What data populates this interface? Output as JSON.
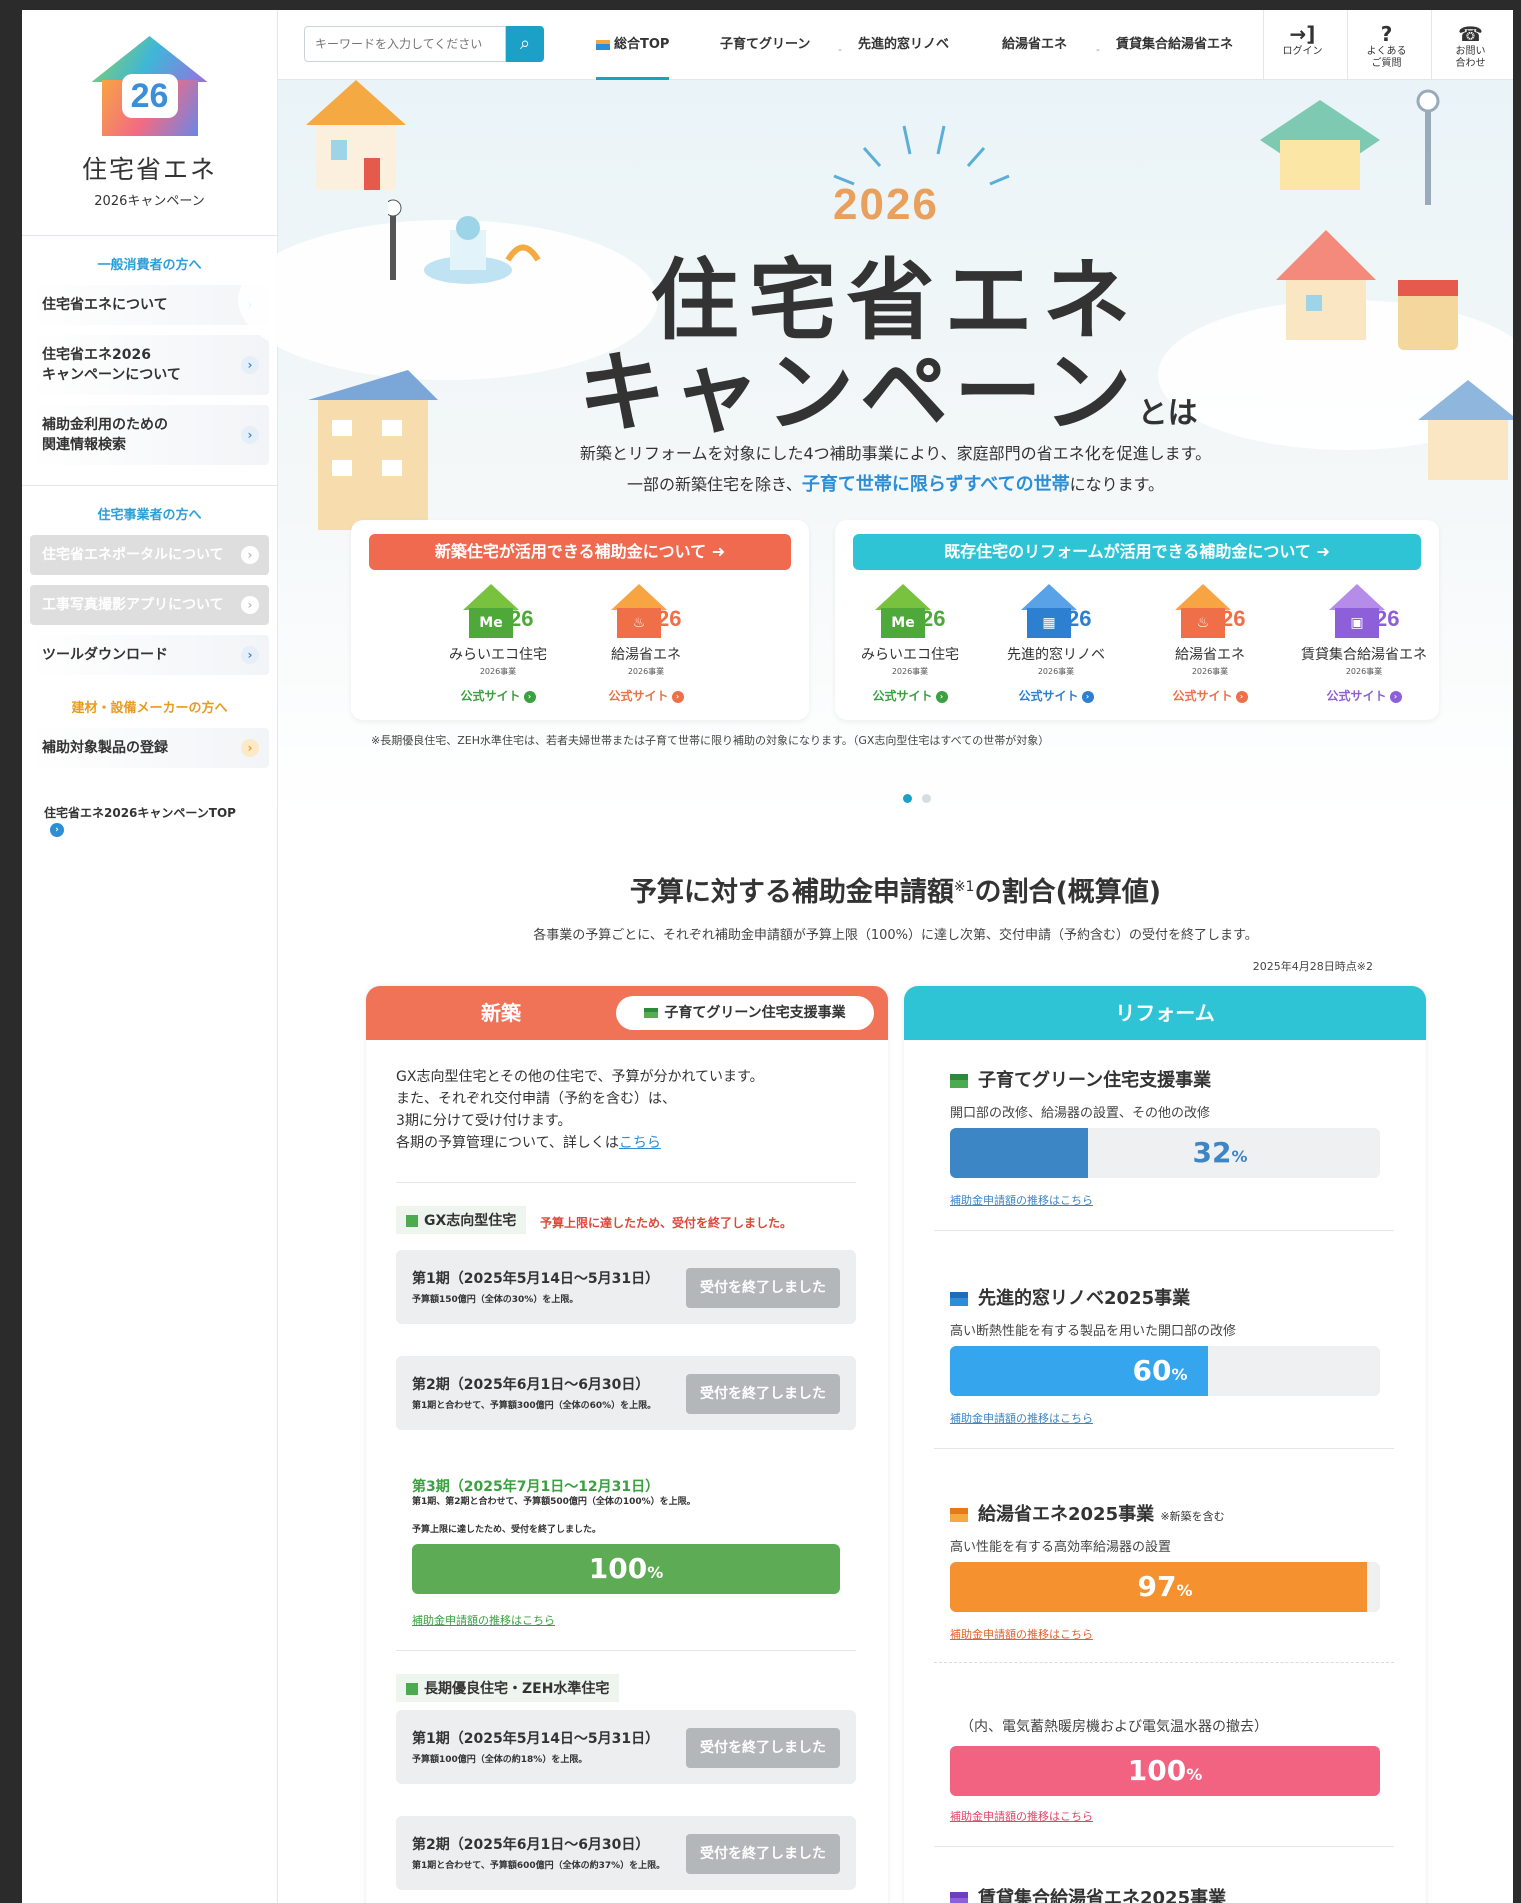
{
  "sidebar": {
    "logo_number": "26",
    "logo_title": "住宅省エネ",
    "logo_sub": "2026キャンペーン",
    "consumer_head": "一般消費者の方へ",
    "consumer_items": [
      "住宅省エネについて",
      "住宅省エネ2026\nキャンペーンについて",
      "補助金利用のための\n関連情報検索"
    ],
    "business_head": "住宅事業者の方へ",
    "business_items": [
      "住宅省エネポータルについて",
      "工事写真撮影アプリについて",
      "ツールダウンロード"
    ],
    "maker_head": "建材・設備メーカーの方へ",
    "maker_items": [
      "補助対象製品の登録"
    ],
    "top_link": "住宅省エネ2026キャンペーンTOP"
  },
  "topbar": {
    "search_placeholder": "キーワードを入力してください",
    "nav": [
      "総合TOP",
      "子育てグリーン",
      "先進的窓リノベ",
      "給湯省エネ",
      "賃貸集合給湯省エネ"
    ],
    "login": "ログイン",
    "faq": "よくある\nご質問",
    "contact": "お問い\n合わせ"
  },
  "hero": {
    "year": "2026",
    "title_line1": "住宅省エネ",
    "title_line2": "キャンペーン",
    "title_suffix": "とは",
    "desc1": "新築とリフォームを対象にした4つ補助事業により、家庭部門の省エネ化を促進します。",
    "desc2_pre": "一部の新築住宅を除き、",
    "desc2_em": "子育て世帯に限らずすべての世帯",
    "desc2_post": "になります。",
    "new_panel_title": "新築住宅が活用できる補助金について",
    "reform_panel_title": "既存住宅のリフォームが活用できる補助金について",
    "new_cards": [
      {
        "name": "みらいエコ住宅",
        "year": "2026事業",
        "link": "公式サイト",
        "num": "26",
        "icon_text": "Me"
      },
      {
        "name": "給湯省エネ",
        "year": "2026事業",
        "link": "公式サイト",
        "num": "26",
        "icon_text": "♨"
      }
    ],
    "reform_cards": [
      {
        "name": "みらいエコ住宅",
        "year": "2026事業",
        "link": "公式サイト",
        "num": "26",
        "icon_text": "Me"
      },
      {
        "name": "先進的窓リノベ",
        "year": "2026事業",
        "link": "公式サイト",
        "num": "26",
        "icon_text": "▦"
      },
      {
        "name": "給湯省エネ",
        "year": "2026事業",
        "link": "公式サイト",
        "num": "26",
        "icon_text": "♨"
      },
      {
        "name": "賃貸集合給湯省エネ",
        "year": "2026事業",
        "link": "公式サイト",
        "num": "26",
        "icon_text": "▣"
      }
    ],
    "note": "※長期優良住宅、ZEH水準住宅は、若者夫婦世帯または子育て世帯に限り補助の対象になります。（GX志向型住宅はすべての世帯が対象）"
  },
  "budget": {
    "title": "予算に対する補助金申請額",
    "title_sup": "※1",
    "title_post": "の割合(概算値)",
    "desc": "各事業の予算ごとに、それぞれ補助金申請額が予算上限（100%）に達し次第、交付申請（予約含む）の受付を終了します。",
    "date": "2025年4月28日時点※2",
    "new_label": "新築",
    "new_tag": "子育てグリーン住宅支援事業",
    "reform_label": "リフォーム",
    "intro_lines": [
      "GX志向型住宅とその他の住宅で、予算が分かれています。",
      "また、それぞれ交付申請（予約を含む）は、",
      "3期に分けて受け付けます。"
    ],
    "intro_last": "各期の予算管理について、詳しくは",
    "intro_link": "こちら",
    "gx_label": "GX志向型住宅",
    "gx_notice": "予算上限に達したため、受付を終了しました。",
    "gx_periods": [
      {
        "title": "第1期（2025年5月14日〜5月31日）",
        "desc": "予算額150億円（全体の30%）を上限。",
        "button": "受付を終了しました"
      },
      {
        "title": "第2期（2025年6月1日〜6月30日）",
        "desc": "第1期と合わせて、予算額300億円（全体の60%）を上限。",
        "button": "受付を終了しました"
      }
    ],
    "gx_p3_title": "第3期（2025年7月1日〜12月31日）",
    "gx_p3_desc1": "第1期、第2期と合わせて、予算額500億円（全体の100%）を上限。",
    "gx_p3_desc2": "予算上限に達したため、受付を終了しました。",
    "gx_p3_percent": 100,
    "gx_p3_link": "補助金申請額の推移はこちら",
    "long_label": "長期優良住宅・ZEH水準住宅",
    "long_periods": [
      {
        "title": "第1期（2025年5月14日〜5月31日）",
        "desc": "予算額100億円（全体の約18%）を上限。",
        "button": "受付を終了しました"
      },
      {
        "title": "第2期（2025年6月1日〜6月30日）",
        "desc": "第1期と合わせて、予算額600億円（全体の約37%）を上限。",
        "button": "受付を終了しました"
      }
    ],
    "reform_items": [
      {
        "title": "子育てグリーン住宅支援事業",
        "desc": "開口部の改修、給湯器の設置、その他の改修",
        "percent": 32,
        "color": "#3d86c6",
        "text_color": "#3d86c6",
        "link": "補助金申請額の推移はこちら",
        "icon_color": "#4caa4f"
      },
      {
        "title": "先進的窓リノベ2025事業",
        "desc": "高い断熱性能を有する製品を用いた開口部の改修",
        "percent": 60,
        "color": "#35a5ee",
        "text_color": "#ffffff",
        "link": "補助金申請額の推移はこちら",
        "icon_color": "#2d8ed8"
      },
      {
        "title": "給湯省エネ2025事業",
        "title_note": "※新築を含む",
        "desc": "高い性能を有する高効率給湯器の設置",
        "percent": 97,
        "color": "#f5922f",
        "text_color": "#ffffff",
        "link": "補助金申請額の推移はこちら",
        "icon_color": "#f5922f"
      }
    ],
    "reform_sub_desc": "（内、電気蓄熱暖房機および電気温水器の撤去）",
    "reform_sub_percent": 100,
    "reform_sub_link": "補助金申請額の推移はこちら",
    "reform_last_title": "賃貸集合給湯省エネ2025事業",
    "percent_unit": "%"
  }
}
